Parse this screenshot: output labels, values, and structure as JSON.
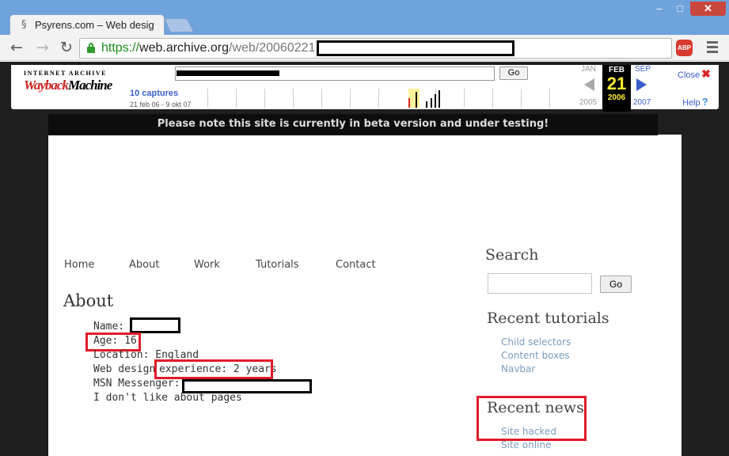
{
  "browser": {
    "tab_title": "Psyrens.com – Web design",
    "favicon": "§",
    "url": {
      "scheme": "https://",
      "host": "web.archive.org",
      "path": "/web/20060221"
    },
    "window_controls": {
      "minimize": "–",
      "maximize": "□",
      "close": "✕"
    },
    "abp_label": "ABP"
  },
  "wayback": {
    "logo_top": "INTERNET ARCHIVE",
    "logo_main_1": "Wayback",
    "logo_main_2": "Machine",
    "go_label": "Go",
    "captures": "10 captures",
    "range": "21 feb 06 - 9 okt 07",
    "prev_month": "JAN",
    "prev_year": "2005",
    "current_month": "FEB",
    "current_day": "21",
    "current_year": "2006",
    "next_month": "SEP",
    "next_year": "2007",
    "close_label": "Close",
    "help_label": "Help",
    "colors": {
      "link": "#3a5fcd",
      "current_bg": "#000000",
      "current_text": "#ffee33"
    }
  },
  "beta_notice": "Please note this site is currently in beta version and under testing!",
  "site": {
    "nav": [
      "Home",
      "About",
      "Work",
      "Tutorials",
      "Contact"
    ],
    "about_title": "About",
    "info": {
      "name_label": "Name:",
      "age": "Age: 16",
      "location": "Location: England",
      "web_design_label": "Web design",
      "experience": "experience: 2 years",
      "msn_label": "MSN Messenger:",
      "closing": "I don't like about pages"
    },
    "sidebar": {
      "search_heading": "Search",
      "search_go": "Go",
      "tutorials_heading": "Recent tutorials",
      "tutorials": [
        "Child selectors",
        "Content boxes",
        "Navbar"
      ],
      "news_heading": "Recent news",
      "news": [
        "Site hacked",
        "Site online"
      ]
    }
  },
  "annotations": {
    "highlight_color": "#e01b2a",
    "redaction_color": "#000000"
  }
}
